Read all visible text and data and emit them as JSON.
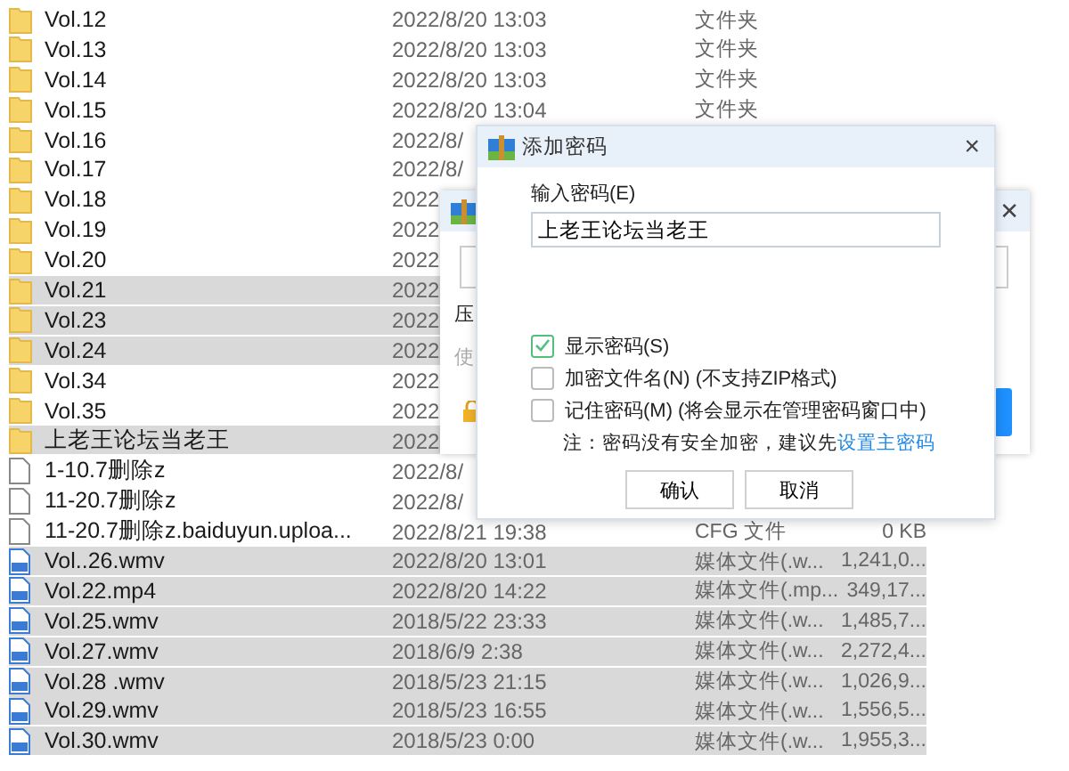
{
  "files": [
    {
      "kind": "folder",
      "name": "Vol.12",
      "date": "2022/8/20 13:03",
      "type": "文件夹",
      "selected": false
    },
    {
      "kind": "folder",
      "name": "Vol.13",
      "date": "2022/8/20 13:03",
      "type": "文件夹",
      "selected": false
    },
    {
      "kind": "folder",
      "name": "Vol.14",
      "date": "2022/8/20 13:03",
      "type": "文件夹",
      "selected": false
    },
    {
      "kind": "folder",
      "name": "Vol.15",
      "date": "2022/8/20 13:04",
      "type": "文件夹",
      "selected": false
    },
    {
      "kind": "folder",
      "name": "Vol.16",
      "date": "2022/8/",
      "selected": false
    },
    {
      "kind": "folder",
      "name": "Vol.17",
      "date": "2022/8/",
      "selected": false
    },
    {
      "kind": "folder",
      "name": "Vol.18",
      "date": "2022",
      "selected": false
    },
    {
      "kind": "folder",
      "name": "Vol.19",
      "date": "2022",
      "selected": false
    },
    {
      "kind": "folder",
      "name": "Vol.20",
      "date": "2022",
      "selected": false
    },
    {
      "kind": "folder",
      "name": "Vol.21",
      "date": "2022",
      "selected": true
    },
    {
      "kind": "folder",
      "name": "Vol.23",
      "date": "2022",
      "selected": true
    },
    {
      "kind": "folder",
      "name": "Vol.24",
      "date": "2022",
      "selected": true
    },
    {
      "kind": "folder",
      "name": "Vol.34",
      "date": "2022",
      "selected": false
    },
    {
      "kind": "folder",
      "name": "Vol.35",
      "date": "2022",
      "selected": false
    },
    {
      "kind": "folder",
      "name": "上老王论坛当老王",
      "date": "2022",
      "selected": true
    },
    {
      "kind": "file",
      "name": "1-10.7删除z",
      "date": "2022/8/",
      "selected": false
    },
    {
      "kind": "file",
      "name": "11-20.7删除z",
      "date": "2022/8/",
      "selected": false
    },
    {
      "kind": "file",
      "name": "11-20.7删除z.baiduyun.uploa...",
      "date": "2022/8/21 19:38",
      "type": "CFG 文件",
      "size": "0 KB",
      "selected": false
    },
    {
      "kind": "media",
      "name": "Vol..26.wmv",
      "date": "2022/8/20 13:01",
      "type": "媒体文件(.w...",
      "size": "1,241,0...",
      "selected": true
    },
    {
      "kind": "media",
      "name": "Vol.22.mp4",
      "date": "2022/8/20 14:22",
      "type": "媒体文件(.mp...",
      "size": "349,17...",
      "selected": true
    },
    {
      "kind": "media",
      "name": "Vol.25.wmv",
      "date": "2018/5/22 23:33",
      "type": "媒体文件(.w...",
      "size": "1,485,7...",
      "selected": true
    },
    {
      "kind": "media",
      "name": "Vol.27.wmv",
      "date": "2018/6/9 2:38",
      "type": "媒体文件(.w...",
      "size": "2,272,4...",
      "selected": true
    },
    {
      "kind": "media",
      "name": "Vol.28 .wmv",
      "date": "2018/5/23 21:15",
      "type": "媒体文件(.w...",
      "size": "1,026,9...",
      "selected": true
    },
    {
      "kind": "media",
      "name": "Vol.29.wmv",
      "date": "2018/5/23 16:55",
      "type": "媒体文件(.w...",
      "size": "1,556,5...",
      "selected": true
    },
    {
      "kind": "media",
      "name": "Vol.30.wmv",
      "date": "2018/5/23 0:00",
      "type": "媒体文件(.w...",
      "size": "1,955,3...",
      "selected": true
    }
  ],
  "back_dialog": {
    "close": "✕",
    "fragments": [
      {
        "text": "压",
        "disabled": false
      },
      {
        "text": "使",
        "disabled": true
      }
    ]
  },
  "password_dialog": {
    "title": "添加密码",
    "close": "×",
    "field_label": "输入密码(E)",
    "password": "上老王论坛当老王",
    "options": [
      {
        "label": "显示密码(S)",
        "checked": true
      },
      {
        "label": "加密文件名(N) (不支持ZIP格式)",
        "checked": false
      },
      {
        "label": "记住密码(M) (将会显示在管理密码窗口中)",
        "checked": false
      }
    ],
    "note": "注：密码没有安全加密，建议先",
    "note_link": "设置主密码",
    "buttons": [
      "确认",
      "取消"
    ]
  }
}
